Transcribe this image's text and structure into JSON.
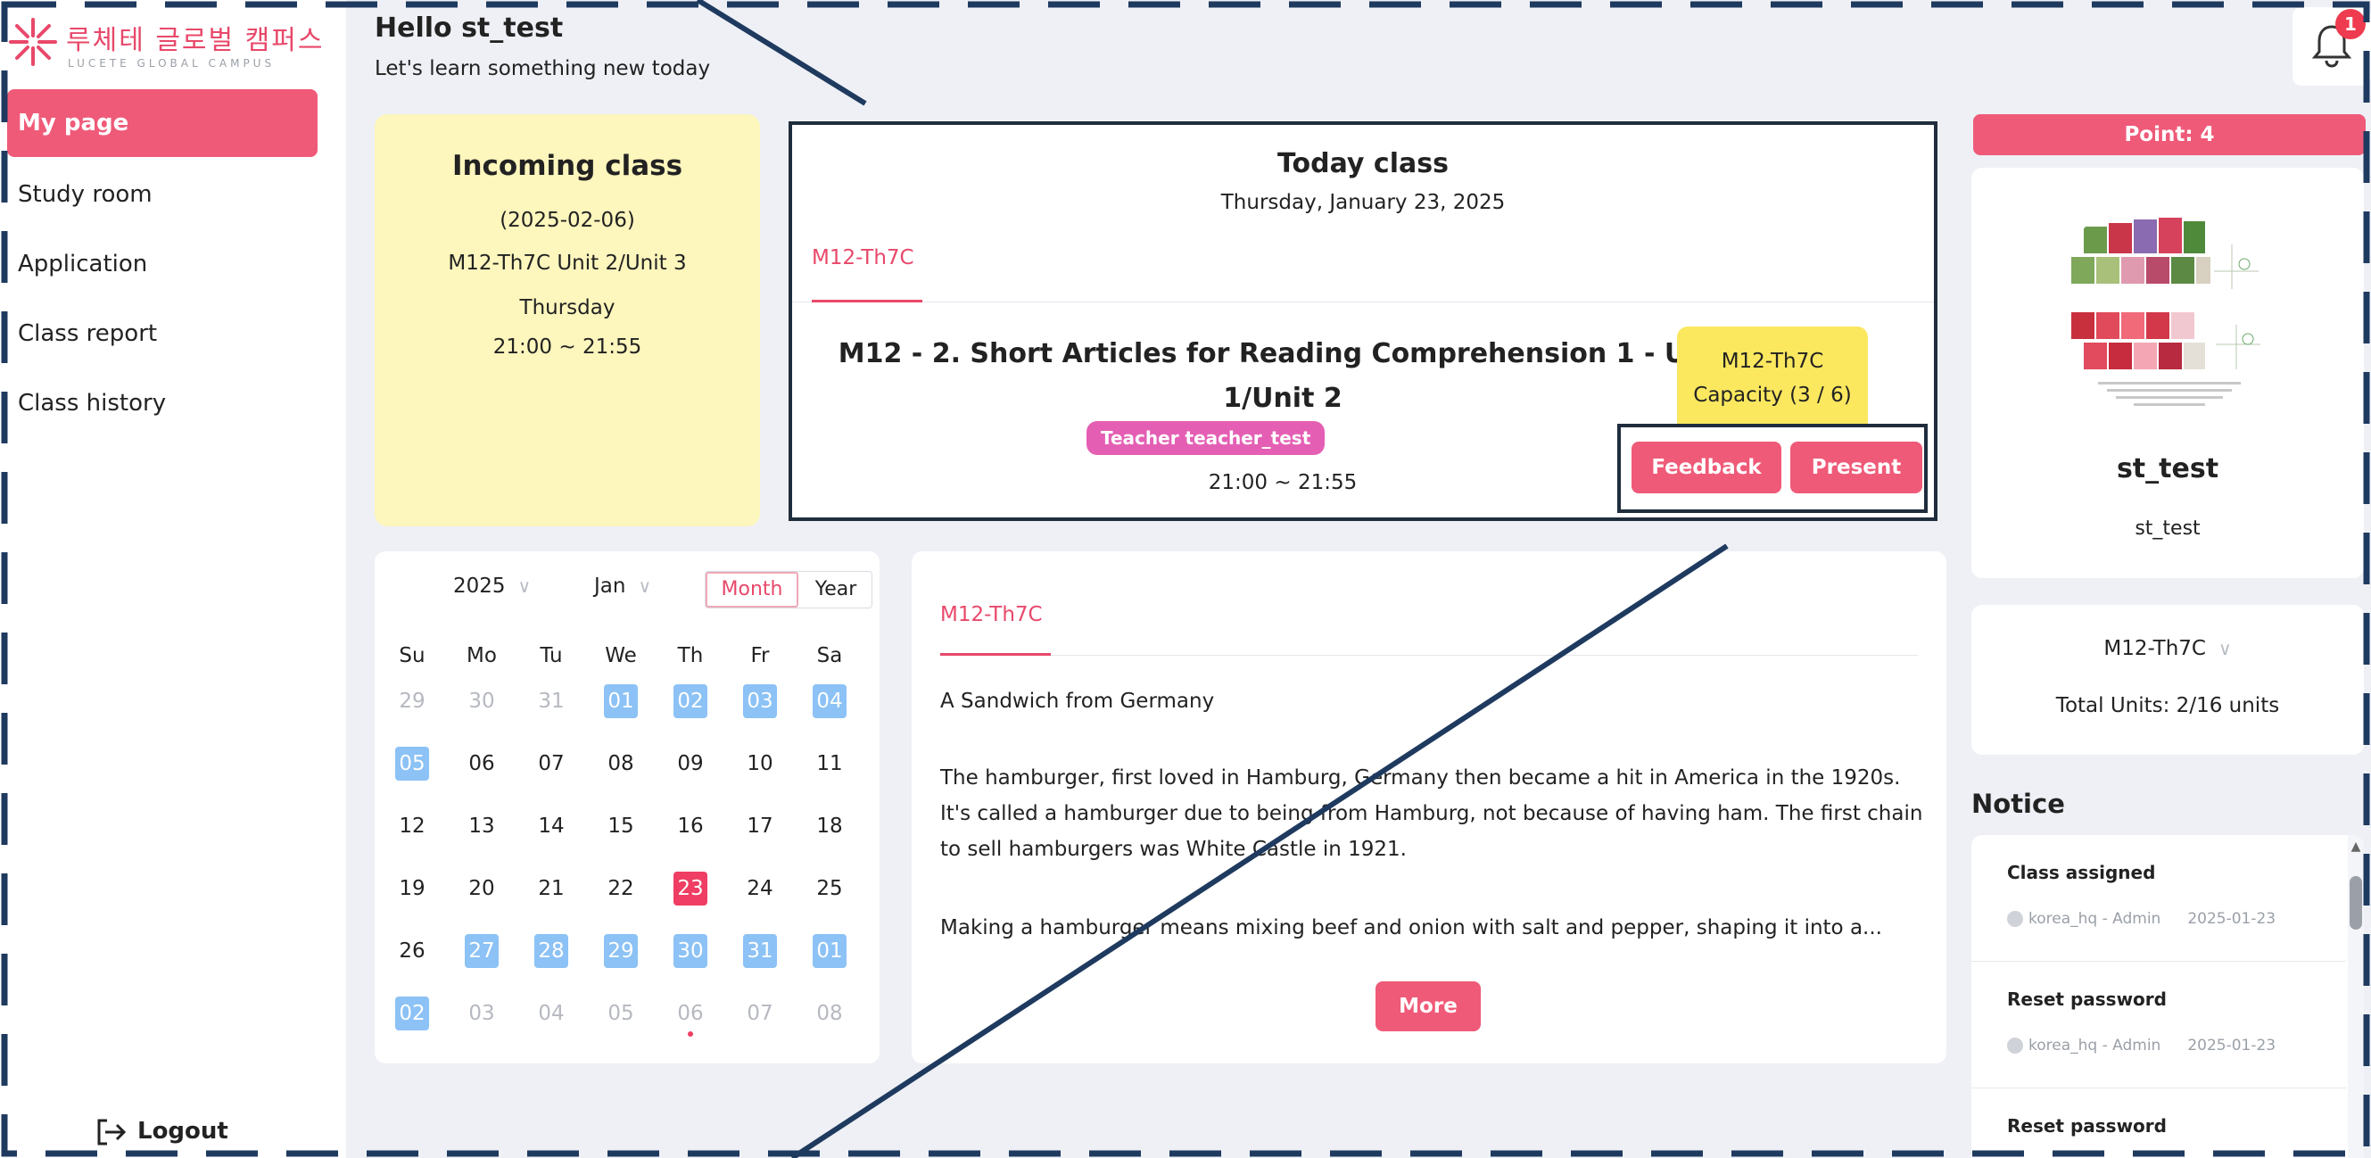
{
  "brand": {
    "name_kr": "루체테 글로벌 캠퍼스",
    "name_en": "LUCETE GLOBAL CAMPUS",
    "accent_color": "#ef5a78"
  },
  "sidebar": {
    "items": [
      {
        "label": "My page",
        "active": true
      },
      {
        "label": "Study room",
        "active": false
      },
      {
        "label": "Application",
        "active": false
      },
      {
        "label": "Class report",
        "active": false
      },
      {
        "label": "Class history",
        "active": false
      }
    ],
    "logout_label": "Logout"
  },
  "header": {
    "greeting": "Hello st_test",
    "subtitle": "Let's learn something new today",
    "notification_count": "1"
  },
  "incoming_class": {
    "title": "Incoming class",
    "date": "(2025-02-06)",
    "units": "M12-Th7C Unit 2/Unit 3",
    "day": "Thursday",
    "time": "21:00 ~ 21:55"
  },
  "today_class": {
    "title": "Today class",
    "date": "Thursday, January 23, 2025",
    "tab": "M12-Th7C",
    "lesson_title": "M12 - 2. Short Articles for Reading Comprehension 1 - Unit 1/Unit 2",
    "teacher": "Teacher teacher_test",
    "time": "21:00 ~ 21:55",
    "class_code": "M12-Th7C",
    "capacity": "Capacity (3 / 6)",
    "feedback_label": "Feedback",
    "present_label": "Present"
  },
  "calendar": {
    "year": "2025",
    "month": "Jan",
    "view_month": "Month",
    "view_year": "Year",
    "weekdays": [
      "Su",
      "Mo",
      "Tu",
      "We",
      "Th",
      "Fr",
      "Sa"
    ],
    "weeks": [
      [
        {
          "d": "29",
          "s": "mute"
        },
        {
          "d": "30",
          "s": "mute"
        },
        {
          "d": "31",
          "s": "mute"
        },
        {
          "d": "01",
          "s": "hl"
        },
        {
          "d": "02",
          "s": "hl"
        },
        {
          "d": "03",
          "s": "hl"
        },
        {
          "d": "04",
          "s": "hl"
        }
      ],
      [
        {
          "d": "05",
          "s": "hl"
        },
        {
          "d": "06",
          "s": ""
        },
        {
          "d": "07",
          "s": ""
        },
        {
          "d": "08",
          "s": ""
        },
        {
          "d": "09",
          "s": ""
        },
        {
          "d": "10",
          "s": ""
        },
        {
          "d": "11",
          "s": ""
        }
      ],
      [
        {
          "d": "12",
          "s": ""
        },
        {
          "d": "13",
          "s": ""
        },
        {
          "d": "14",
          "s": ""
        },
        {
          "d": "15",
          "s": ""
        },
        {
          "d": "16",
          "s": ""
        },
        {
          "d": "17",
          "s": ""
        },
        {
          "d": "18",
          "s": ""
        }
      ],
      [
        {
          "d": "19",
          "s": ""
        },
        {
          "d": "20",
          "s": ""
        },
        {
          "d": "21",
          "s": ""
        },
        {
          "d": "22",
          "s": ""
        },
        {
          "d": "23",
          "s": "today"
        },
        {
          "d": "24",
          "s": ""
        },
        {
          "d": "25",
          "s": ""
        }
      ],
      [
        {
          "d": "26",
          "s": ""
        },
        {
          "d": "27",
          "s": "hl"
        },
        {
          "d": "28",
          "s": "hl"
        },
        {
          "d": "29",
          "s": "hl"
        },
        {
          "d": "30",
          "s": "hl"
        },
        {
          "d": "31",
          "s": "hl"
        },
        {
          "d": "01",
          "s": "hl"
        }
      ],
      [
        {
          "d": "02",
          "s": "hl"
        },
        {
          "d": "03",
          "s": "mute"
        },
        {
          "d": "04",
          "s": "mute"
        },
        {
          "d": "05",
          "s": "mute"
        },
        {
          "d": "06",
          "s": "mute"
        },
        {
          "d": "07",
          "s": "mute"
        },
        {
          "d": "08",
          "s": "mute"
        }
      ]
    ],
    "colors": {
      "highlight": "#8cc2f5",
      "today": "#ef3d63"
    }
  },
  "article": {
    "tab": "M12-Th7C",
    "title": "A Sandwich from Germany",
    "para1": "The hamburger, first loved in Hamburg, Germany then became a hit in America in the 1920s. It's called a hamburger due to being from Hamburg, not because of having ham. The first chain to sell hamburgers was White Castle in 1921.",
    "para2": "Making a hamburger means mixing beef and onion with salt and pepper, shaping it into a...",
    "more_label": "More"
  },
  "profile": {
    "points": "Point: 4",
    "name": "st_test",
    "id": "st_test"
  },
  "units": {
    "selected": "M12-Th7C",
    "total": "Total Units: 2/16 units"
  },
  "notice": {
    "title": "Notice",
    "items": [
      {
        "title": "Class assigned",
        "author": "korea_hq - Admin",
        "date": "2025-01-23"
      },
      {
        "title": "Reset password",
        "author": "korea_hq - Admin",
        "date": "2025-01-23"
      },
      {
        "title": "Reset password",
        "author": "",
        "date": ""
      }
    ]
  }
}
